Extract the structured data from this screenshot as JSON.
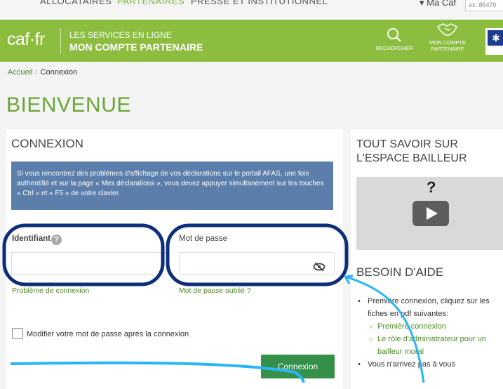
{
  "topnav": {
    "items": [
      "ALLOCATAIRES",
      "PARTENAIRES",
      "PRESSE ET INSTITUTIONNEL"
    ],
    "ma_caf": "Ma Caf",
    "search_placeholder": "ex: 85470"
  },
  "banner": {
    "logo": "caf·fr",
    "subtitle": "LES SERVICES EN LIGNE",
    "title": "MON COMPTE PARTENAIRE",
    "search_label": "RECHERCHER",
    "partner_label_1": "MON COMPTE",
    "partner_label_2": "PARTENAIRE"
  },
  "breadcrumb": {
    "home": "Accueil",
    "separator": "/",
    "current": "Connexion"
  },
  "page_title": "BIENVENUE",
  "login": {
    "heading": "CONNEXION",
    "alert": "Si vous rencontrez des problèmes d'affichage de vos déclarations sur le portail AFAS, une fois authentifié et sur la page « Mes déclarations », vous devez appuyer simultanément sur les touches « Ctrl » et « F5 » de votre clavier.",
    "identifiant_label": "Identifiant",
    "help_glyph": "?",
    "password_label": "Mot de passe",
    "identifiant_value": "",
    "password_value": "",
    "problem_link": "Problème de connexion",
    "forgot_link": "Mot de passe oublié ?",
    "change_password_label": "Modifier votre mot de passe après la connexion",
    "submit": "Connexion"
  },
  "sidebar": {
    "title_line1": "TOUT SAVOIR SUR",
    "title_line2": "L'ESPACE BAILLEUR",
    "video_glyph": "?",
    "help_title": "BESOIN D'AIDE",
    "bullet1": "Première connexion, cliquez sur les fiches en pdf suivantes:",
    "sub1": "Première connexion",
    "sub2": "Le rôle d'administrateur pour un bailleur moral",
    "bullet2": "Vous n'arrivez pas à vous"
  },
  "colors": {
    "brand_green": "#8cbd3f",
    "title_green": "#6aa535",
    "alert_blue": "#5b7eab",
    "button_green": "#35904a",
    "annotation_navy": "#0d2f7a",
    "annotation_cyan": "#29b6f6"
  }
}
